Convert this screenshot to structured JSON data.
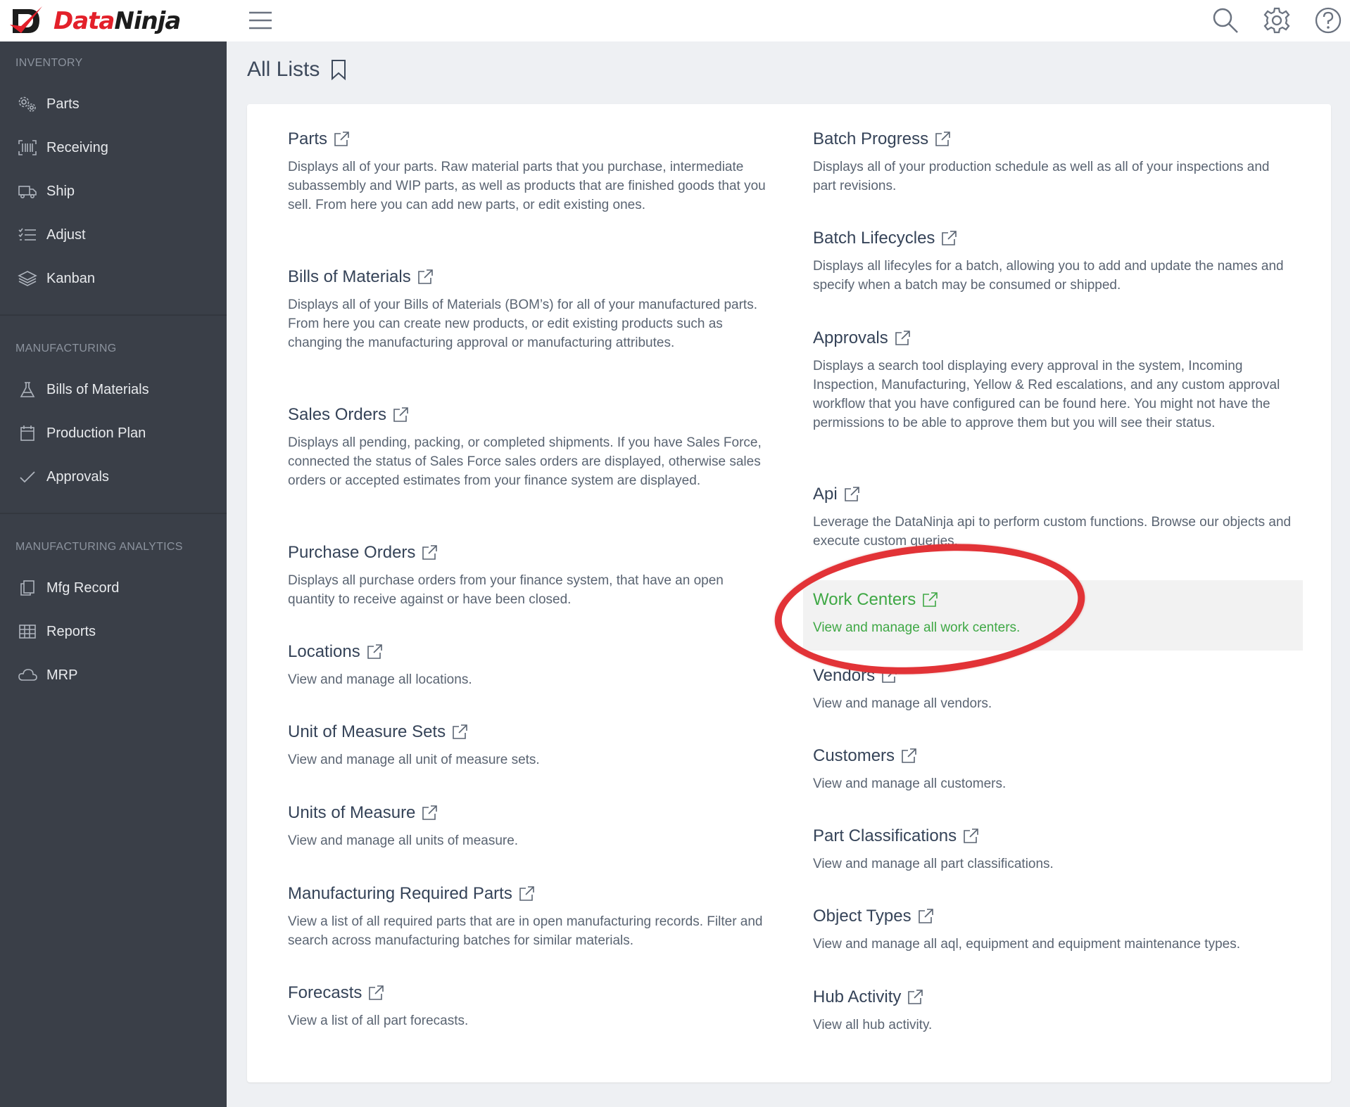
{
  "header": {
    "logo_part1": "Data",
    "logo_part2": "Ninja",
    "icons": [
      "menu-icon",
      "search-icon",
      "gear-icon",
      "help-icon"
    ]
  },
  "sidebar": {
    "sections": [
      {
        "heading": "INVENTORY",
        "items": [
          {
            "label": "Parts",
            "icon": "gears-icon"
          },
          {
            "label": "Receiving",
            "icon": "barcode-icon"
          },
          {
            "label": "Ship",
            "icon": "truck-icon"
          },
          {
            "label": "Adjust",
            "icon": "checklist-icon"
          },
          {
            "label": "Kanban",
            "icon": "layers-icon"
          }
        ]
      },
      {
        "heading": "MANUFACTURING",
        "items": [
          {
            "label": "Bills of Materials",
            "icon": "flask-icon"
          },
          {
            "label": "Production Plan",
            "icon": "calendar-icon"
          },
          {
            "label": "Approvals",
            "icon": "check-icon"
          }
        ]
      },
      {
        "heading": "MANUFACTURING ANALYTICS",
        "items": [
          {
            "label": "Mfg Record",
            "icon": "copy-icon"
          },
          {
            "label": "Reports",
            "icon": "table-icon"
          },
          {
            "label": "MRP",
            "icon": "cloud-icon"
          }
        ]
      }
    ]
  },
  "main": {
    "title": "All Lists",
    "left_entries": [
      {
        "title": "Parts",
        "desc": "Displays all of your parts. Raw material parts that you purchase, intermediate subassembly and WIP parts, as well as products that are finished goods that you sell. From here you can add new parts, or edit existing ones."
      },
      {
        "title": "Bills of Materials",
        "desc": "Displays all of your Bills of Materials (BOM’s) for all of your manufactured parts. From here you can create new products, or edit existing products such as changing the manufacturing approval or manufacturing attributes."
      },
      {
        "title": "Sales Orders",
        "desc": "Displays all pending, packing, or completed shipments. If you have Sales Force, connected the status of Sales Force sales orders are displayed, otherwise sales orders or accepted estimates from your finance system are displayed."
      },
      {
        "title": "Purchase Orders",
        "desc": "Displays all purchase orders from your finance system, that have an open quantity to receive against or have been closed."
      },
      {
        "title": "Locations",
        "desc": "View and manage all locations."
      },
      {
        "title": "Unit of Measure Sets",
        "desc": "View and manage all unit of measure sets."
      },
      {
        "title": "Units of Measure",
        "desc": "View and manage all units of measure."
      },
      {
        "title": "Manufacturing Required Parts",
        "desc": "View a list of all required parts that are in open manufacturing records. Filter and search across manufacturing batches for similar materials."
      },
      {
        "title": "Forecasts",
        "desc": "View a list of all part forecasts."
      }
    ],
    "right_entries": [
      {
        "title": "Batch Progress",
        "desc": "Displays all of your production schedule as well as all of your inspections and part revisions."
      },
      {
        "title": "Batch Lifecycles",
        "desc": "Displays all lifecyles for a batch, allowing you to add and update the names and specify when a batch may be consumed or shipped."
      },
      {
        "title": "Approvals",
        "desc": "Displays a search tool displaying every approval in the system, Incoming Inspection, Manufacturing, Yellow & Red escalations, and any custom approval workflow that you have configured can be found here. You might not have the permissions to be able to approve them but you will see their status."
      },
      {
        "title": "Api",
        "desc": "Leverage the DataNinja api to perform custom functions. Browse our objects and execute custom queries."
      },
      {
        "title": "Work Centers",
        "desc": "View and manage all work centers."
      },
      {
        "title": "Vendors",
        "desc": "View and manage all vendors."
      },
      {
        "title": "Customers",
        "desc": "View and manage all customers."
      },
      {
        "title": "Part Classifications",
        "desc": "View and manage all part classifications."
      },
      {
        "title": "Object Types",
        "desc": "View and manage all aql, equipment and equipment maintenance types."
      },
      {
        "title": "Hub Activity",
        "desc": "View all hub activity."
      }
    ],
    "highlight_color": "#3fa845",
    "annotation_color": "#e23337"
  }
}
